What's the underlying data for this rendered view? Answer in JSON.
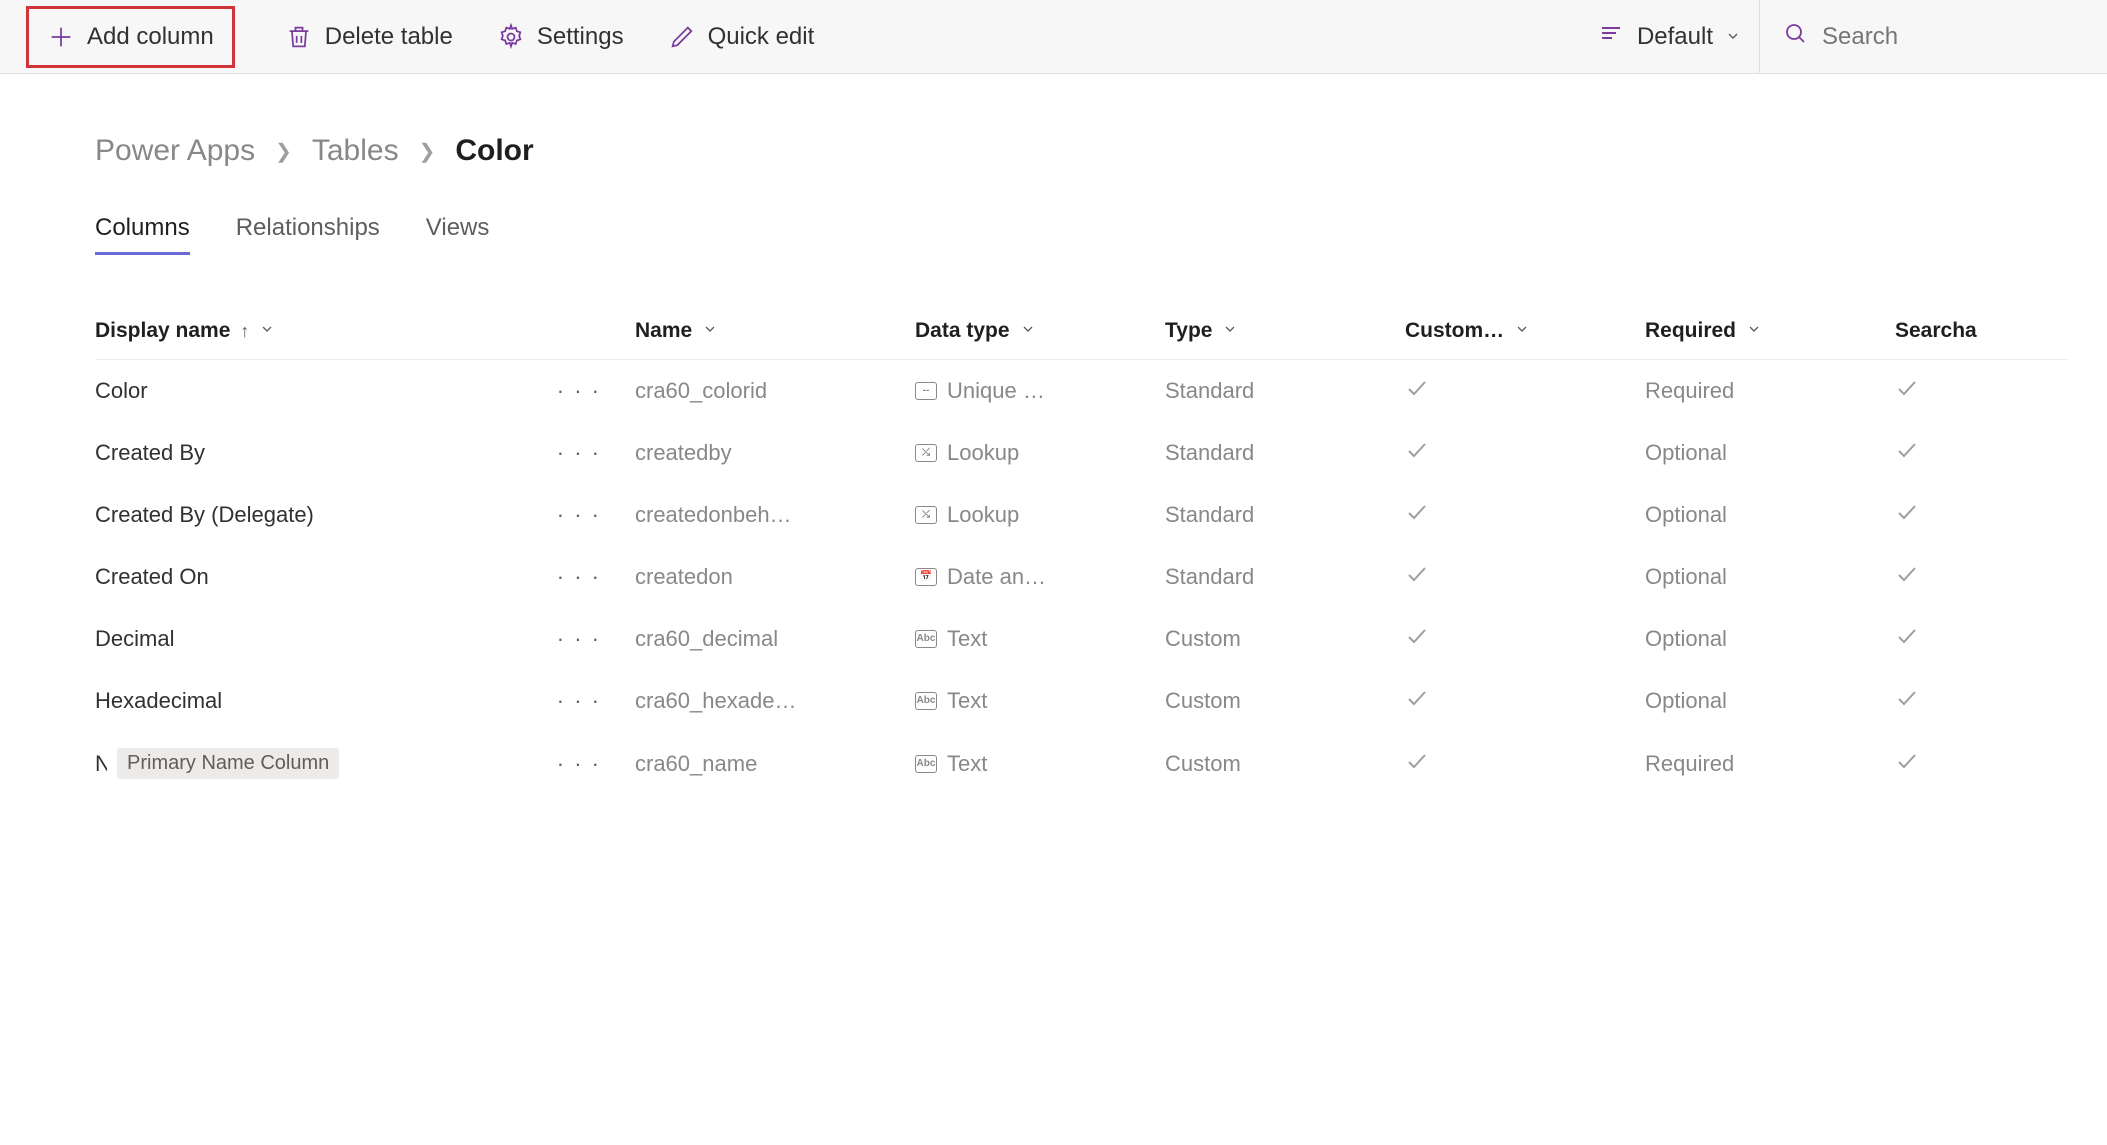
{
  "toolbar": {
    "add_column": "Add column",
    "delete_table": "Delete table",
    "settings": "Settings",
    "quick_edit": "Quick edit",
    "view_selector": "Default",
    "search_placeholder": "Search"
  },
  "breadcrumb": {
    "root": "Power Apps",
    "tables": "Tables",
    "current": "Color"
  },
  "tabs": {
    "columns": "Columns",
    "relationships": "Relationships",
    "views": "Views"
  },
  "headers": {
    "display_name": "Display name",
    "name": "Name",
    "data_type": "Data type",
    "type": "Type",
    "custom": "Custom…",
    "required": "Required",
    "searchable": "Searcha"
  },
  "rows": [
    {
      "display": "Color",
      "name": "cra60_colorid",
      "dtype_icon": "--",
      "dtype": "Unique …",
      "type": "Standard",
      "custom": true,
      "required": "Required",
      "searchable": true
    },
    {
      "display": "Created By",
      "name": "createdby",
      "dtype_icon": "⤯",
      "dtype": "Lookup",
      "type": "Standard",
      "custom": true,
      "required": "Optional",
      "searchable": true
    },
    {
      "display": "Created By (Delegate)",
      "name": "createdonbeh…",
      "dtype_icon": "⤯",
      "dtype": "Lookup",
      "type": "Standard",
      "custom": true,
      "required": "Optional",
      "searchable": true
    },
    {
      "display": "Created On",
      "name": "createdon",
      "dtype_icon": "📅",
      "dtype": "Date an…",
      "type": "Standard",
      "custom": true,
      "required": "Optional",
      "searchable": true
    },
    {
      "display": "Decimal",
      "name": "cra60_decimal",
      "dtype_icon": "Abc",
      "dtype": "Text",
      "type": "Custom",
      "custom": true,
      "required": "Optional",
      "searchable": true
    },
    {
      "display": "Hexadecimal",
      "name": "cra60_hexade…",
      "dtype_icon": "Abc",
      "dtype": "Text",
      "type": "Custom",
      "custom": true,
      "required": "Optional",
      "searchable": true
    },
    {
      "display": "Name",
      "truncated": true,
      "badge": "Primary Name Column",
      "name": "cra60_name",
      "dtype_icon": "Abc",
      "dtype": "Text",
      "type": "Custom",
      "custom": true,
      "required": "Required",
      "searchable": true
    }
  ]
}
